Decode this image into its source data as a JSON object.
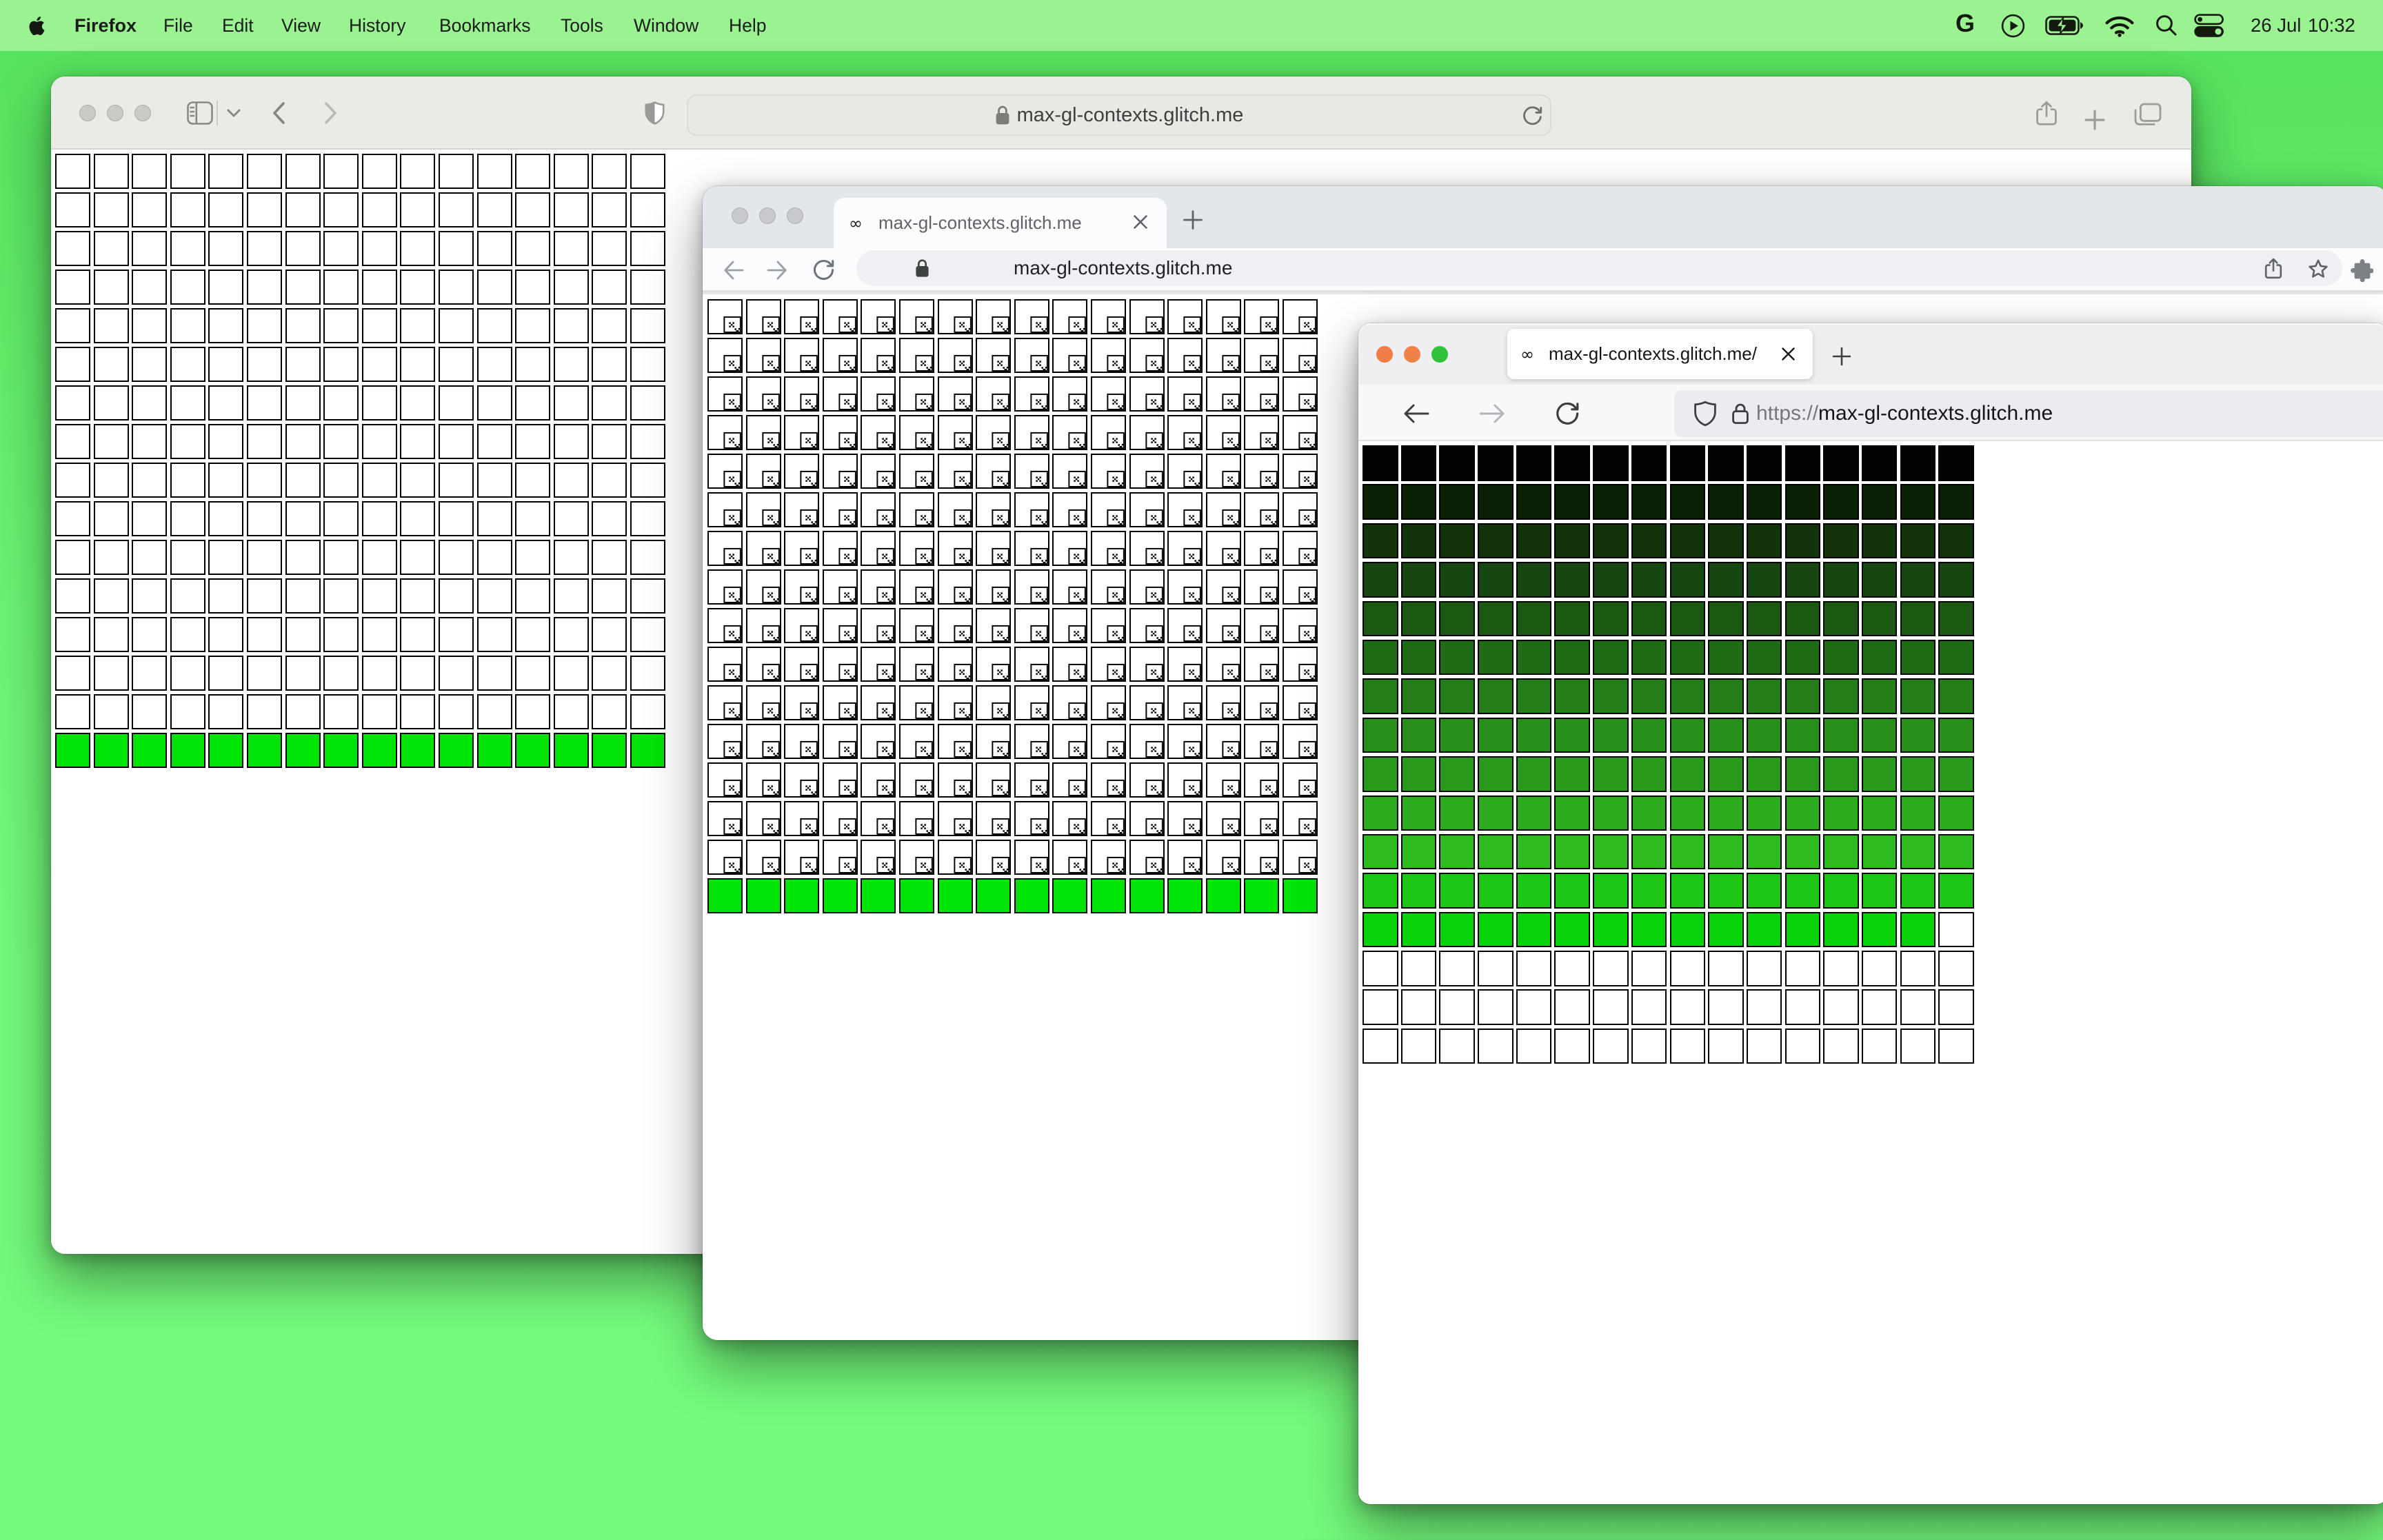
{
  "menu_bar": {
    "apple_icon": "apple-logo",
    "active_app": "Firefox",
    "items": [
      "Firefox",
      "File",
      "Edit",
      "View",
      "History",
      "Bookmarks",
      "Tools",
      "Window",
      "Help"
    ],
    "status": {
      "grammarly_label": "G",
      "date": "26 Jul",
      "time": "10:32",
      "icons": [
        "grammarly-icon",
        "play-circle-icon",
        "battery-charging-icon",
        "wifi-icon",
        "search-icon",
        "control-center-icon"
      ]
    }
  },
  "site": {
    "domain": "max-gl-contexts.glitch.me",
    "favicon_glyph": "∞"
  },
  "windows": {
    "safari": {
      "browser": "Safari",
      "focused": false,
      "url_field_text": "max-gl-contexts.glitch.me",
      "toolbar_icons": [
        "sidebar-icon",
        "chevron-down-icon",
        "back-icon",
        "forward-icon",
        "privacy-shield-icon",
        "lock-icon",
        "reload-icon",
        "share-icon",
        "new-tab-plus-icon",
        "tabs-overview-icon"
      ]
    },
    "chrome": {
      "browser": "Chrome",
      "focused": false,
      "tab_title": "max-gl-contexts.glitch.me",
      "tab_favicon": "∞",
      "omnibox_text": "max-gl-contexts.glitch.me",
      "toolbar_icons": [
        "back-icon",
        "forward-icon",
        "reload-icon",
        "lock-icon",
        "share-icon",
        "bookmark-star-icon",
        "extensions-puzzle-icon",
        "tab-close-icon",
        "new-tab-plus-icon"
      ]
    },
    "firefox": {
      "browser": "Firefox",
      "focused": true,
      "tab_title": "max-gl-contexts.glitch.me/",
      "tab_favicon": "∞",
      "urlbar_scheme": "https://",
      "urlbar_domain": "max-gl-contexts.glitch.me",
      "toolbar_icons": [
        "back-icon",
        "forward-icon",
        "reload-icon",
        "tracking-shield-icon",
        "lock-icon",
        "tab-close-icon",
        "new-tab-plus-icon"
      ]
    }
  },
  "colors": {
    "desktop_green_top": "#54e15c",
    "desktop_green_bottom": "#74fb7c",
    "menubar_green": "#9af291",
    "alive_canvas_green": "#00e306",
    "tile_border": "#000000",
    "traffic_inactive_safari": "#c9cbc5",
    "traffic_inactive_chrome": "#c8cacd",
    "traffic_firefox": [
      "#ee7e46",
      "#f08147",
      "#31c13c"
    ]
  },
  "grids": {
    "safari": {
      "kind": "blank-then-green",
      "cols": 16,
      "rows": 16,
      "blank_rows": 15,
      "green_row_color": "#00e306",
      "tile_fill": "#ffffff"
    },
    "chrome": {
      "kind": "broken-then-green",
      "cols": 16,
      "rows": 16,
      "broken_rows": 15,
      "green_row_color": "#00e306",
      "tile_fill": "#ffffff"
    },
    "firefox": {
      "kind": "gradient-then-blank",
      "cols": 16,
      "rows": 16,
      "row_colors": [
        "#000300",
        "#0a2106",
        "#11340b",
        "#164710",
        "#1b5913",
        "#206b16",
        "#247d19",
        "#288f1b",
        "#2a9a1c",
        "#2daa1e",
        "#2fba1f",
        "#1ec616",
        "#06d406"
      ],
      "partial_row_index": 12,
      "partial_row_count": 15,
      "blank_rows_after": 3,
      "tile_fill": "#ffffff"
    }
  }
}
